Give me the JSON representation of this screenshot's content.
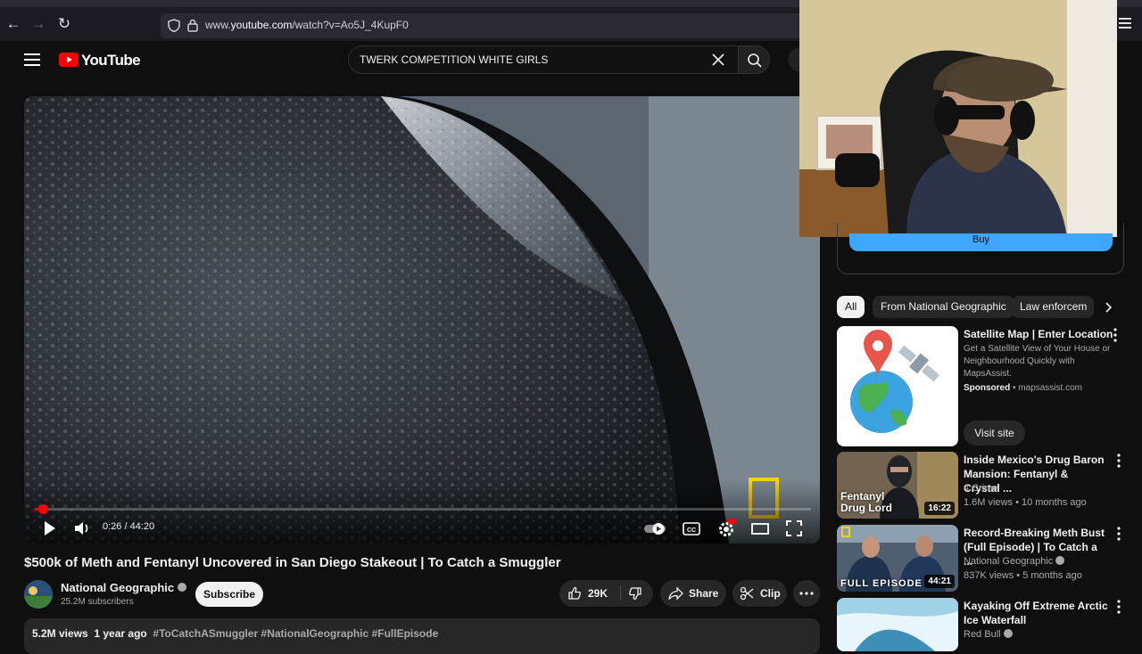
{
  "browser": {
    "url_prefix": "www.",
    "url_domain": "youtube.com",
    "url_path": "/watch?v=Ao5J_4KupF0"
  },
  "header": {
    "logo_text": "YouTube",
    "search_value": "TWERK COMPETITION WHITE GIRLS"
  },
  "player": {
    "time_current": "0:26",
    "time_sep": " / ",
    "time_total": "44:20",
    "progress_fraction": 0.0098
  },
  "video": {
    "title": "$500k of Meth and Fentanyl Uncovered in San Diego Stakeout | To Catch a Smuggler",
    "channel": "National Geographic",
    "subscribers": "25.2M subscribers",
    "subscribe_label": "Subscribe",
    "likes": "29K",
    "share_label": "Share",
    "clip_label": "Clip",
    "views": "5.2M views",
    "age": "1 year ago",
    "hashtags": "#ToCatchASmuggler #NationalGeographic #FullEpisode"
  },
  "sidebar": {
    "buy_label": "Buy",
    "chips": [
      "All",
      "From National Geographic",
      "Law enforcem"
    ],
    "ad": {
      "title": "Satellite Map | Enter Location",
      "desc": "Get a Satellite View of Your House or Neighbourhood Quickly with MapsAssist.",
      "sponsored": "Sponsored",
      "sep": " • ",
      "domain": "mapsassist.com",
      "cta": "Visit site"
    },
    "videos": [
      {
        "title": "Inside Mexico's Drug Baron Mansion: Fentanyl & Crystal ...",
        "channel": "4 Crime",
        "meta": "1.6M views • 10 months ago",
        "duration": "16:22",
        "thumb_text": "Fentanyl Drug Lord"
      },
      {
        "title": "Record-Breaking Meth Bust (Full Episode) | To Catch a ...",
        "channel": "National Geographic",
        "meta": "837K views • 5 months ago",
        "duration": "44:21",
        "thumb_text": "FULL EPISODE"
      },
      {
        "title": "Kayaking Off Extreme Arctic Ice Waterfall",
        "channel": "Red Bull",
        "meta": "",
        "duration": "",
        "thumb_text": ""
      }
    ]
  },
  "colors": {
    "accent": "#ff0000",
    "link": "#3ea6ff",
    "natgeo": "#ffd200"
  }
}
